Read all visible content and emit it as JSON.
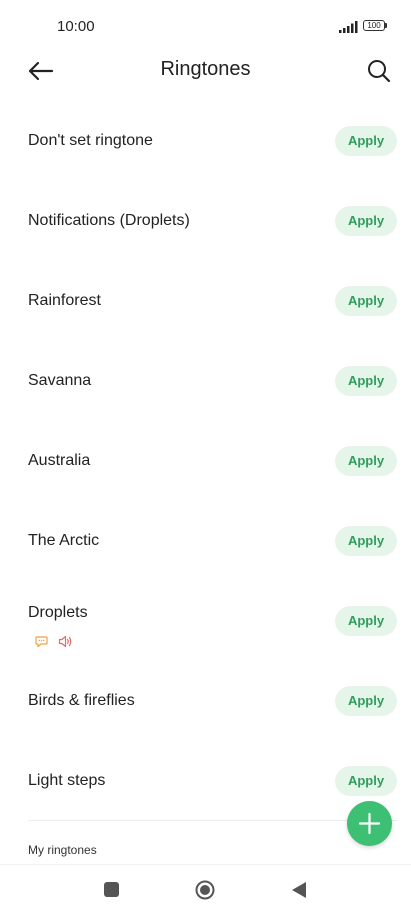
{
  "status_bar": {
    "time": "10:00",
    "battery": "100",
    "icons": [
      "signal-icon",
      "battery-icon"
    ]
  },
  "header": {
    "title": "Ringtones",
    "back_icon": "arrow-left-icon",
    "search_icon": "search-icon"
  },
  "ringtones": [
    {
      "name": "Don't set ringtone",
      "action": "Apply"
    },
    {
      "name": "Notifications (Droplets)",
      "action": "Apply"
    },
    {
      "name": "Rainforest",
      "action": "Apply"
    },
    {
      "name": "Savanna",
      "action": "Apply"
    },
    {
      "name": "Australia",
      "action": "Apply"
    },
    {
      "name": "The Arctic",
      "action": "Apply"
    },
    {
      "name": "Droplets",
      "action": "Apply",
      "icons": [
        "message-icon",
        "speaker-icon"
      ]
    },
    {
      "name": "Birds & fireflies",
      "action": "Apply"
    },
    {
      "name": "Light steps",
      "action": "Apply"
    }
  ],
  "my_ringtones": {
    "title": "My ringtones"
  },
  "fab": {
    "icon": "plus-icon"
  },
  "colors": {
    "accent": "#3dbf74",
    "apply_bg": "#e5f5ea",
    "apply_text": "#2e9e5b",
    "message_icon": "#f0a040",
    "speaker_icon": "#e86a6a"
  },
  "nav_bar": {
    "icons": [
      "recents-icon",
      "home-icon",
      "back-icon"
    ]
  }
}
